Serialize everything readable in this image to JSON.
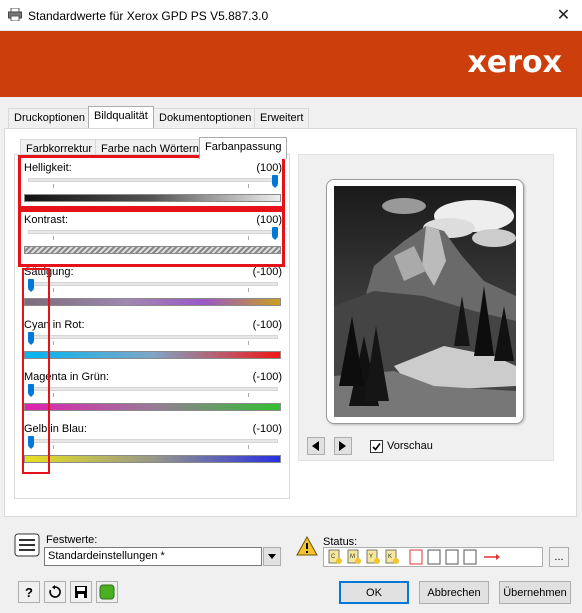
{
  "window": {
    "title": "Standardwerte für Xerox GPD PS V5.887.3.0",
    "close_glyph": "✕"
  },
  "brand": {
    "logo_text": "xerox",
    "banner_color": "#cc3f0c"
  },
  "main_tabs": [
    {
      "label": "Druckoptionen",
      "active": false
    },
    {
      "label": "Bildqualität",
      "active": true
    },
    {
      "label": "Dokumentoptionen",
      "active": false
    },
    {
      "label": "Erweitert",
      "active": false
    }
  ],
  "sub_tabs": [
    {
      "label": "Farbkorrektur",
      "active": false
    },
    {
      "label": "Farbe nach Wörtern",
      "active": false
    },
    {
      "label": "Farbanpassung",
      "active": true
    }
  ],
  "sliders": [
    {
      "label": "Helligkeit:",
      "value": "(100)",
      "level": 1.0,
      "bar": "brightness"
    },
    {
      "label": "Kontrast:",
      "value": "(100)",
      "level": 1.0,
      "bar": "contrast"
    },
    {
      "label": "Sättigung:",
      "value": "(-100)",
      "level": 0.0,
      "bar": "saturation"
    },
    {
      "label": "Cyan in Rot:",
      "value": "(-100)",
      "level": 0.0,
      "bar": "cyan-red"
    },
    {
      "label": "Magenta in Grün:",
      "value": "(-100)",
      "level": 0.0,
      "bar": "magenta-green"
    },
    {
      "label": "Gelb in Blau:",
      "value": "(-100)",
      "level": 0.0,
      "bar": "yellow-blue"
    }
  ],
  "preview": {
    "checkbox_label": "Vorschau",
    "checked": true,
    "image_icon": "mountain-landscape-grayscale"
  },
  "presets": {
    "label": "Festwerte:",
    "value": "Standardeinstellungen *",
    "icon": "presets-icon"
  },
  "status": {
    "label": "Status:",
    "icon": "warning-icon",
    "more": "..."
  },
  "footer": {
    "ok": "OK",
    "cancel": "Abbrechen",
    "apply": "Übernehmen"
  },
  "colors": {
    "highlight": "#e5121a",
    "accent": "#0078d7"
  }
}
